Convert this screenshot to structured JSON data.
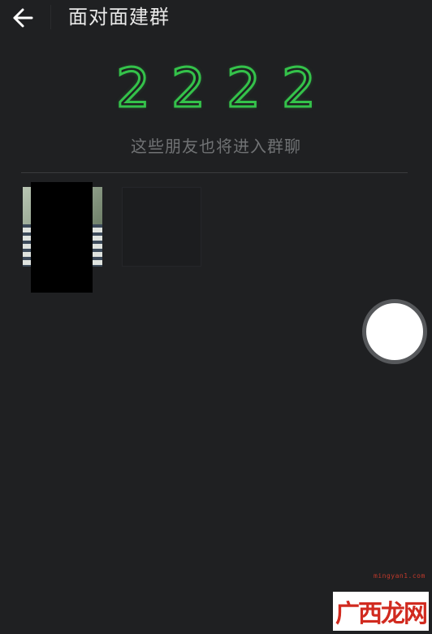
{
  "header": {
    "back_icon": "back-arrow-icon",
    "title": "面对面建群"
  },
  "code": {
    "digits": [
      "2",
      "2",
      "2",
      "2"
    ],
    "color": "#34c24a"
  },
  "hint": "这些朋友也将进入群聊",
  "members": {
    "count_visible": 1
  },
  "watermark": {
    "url": "mingyan1.com",
    "logo_text": "广西龙网"
  },
  "colors": {
    "background": "#1f2022",
    "accent": "#34c24a"
  }
}
